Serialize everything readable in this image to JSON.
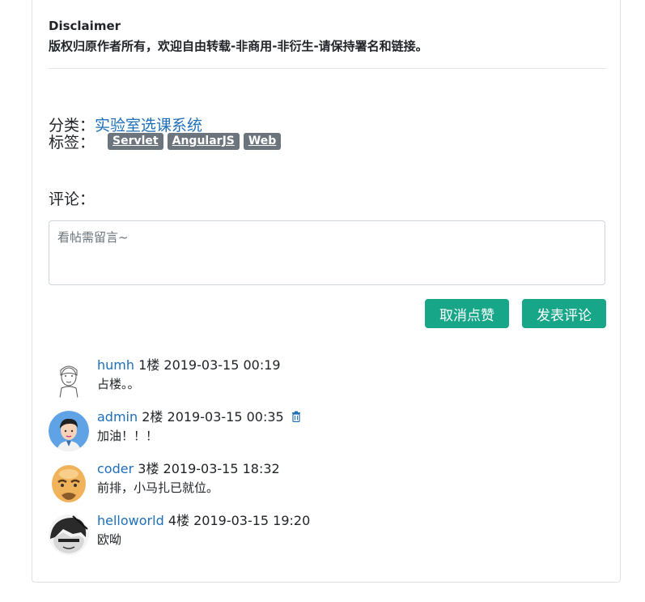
{
  "disclaimer": {
    "title": "Disclaimer",
    "text": "版权归原作者所有，欢迎自由转载-非商用-非衍生-请保持署名和链接。"
  },
  "category": {
    "label": "分类：",
    "value": "实验室选课系统"
  },
  "tags": {
    "label": "标签：",
    "items": [
      "Servlet",
      "AngularJS",
      "Web"
    ]
  },
  "comment_form": {
    "label": "评论：",
    "placeholder": "看帖需留言~",
    "value": "",
    "unlike_label": "取消点赞",
    "post_label": "发表评论"
  },
  "comments": [
    {
      "user": "humh",
      "floor": "1楼",
      "time": "2019-03-15 00:19",
      "text": "占楼。。",
      "avatar_icon": "sketch-boy-avatar",
      "deletable": false
    },
    {
      "user": "admin",
      "floor": "2楼",
      "time": "2019-03-15 00:35",
      "text": "加油！！！",
      "avatar_icon": "man-blue-avatar",
      "deletable": true
    },
    {
      "user": "coder",
      "floor": "3楼",
      "time": "2019-03-15 18:32",
      "text": "前排，小马扎已就位。",
      "avatar_icon": "bald-man-avatar",
      "deletable": false
    },
    {
      "user": "helloworld",
      "floor": "4楼",
      "time": "2019-03-15 19:20",
      "text": "欧呦",
      "avatar_icon": "manga-avatar",
      "deletable": false
    }
  ],
  "colors": {
    "link": "#1e6fba",
    "button": "#18a689",
    "badge": "#6c757d"
  }
}
